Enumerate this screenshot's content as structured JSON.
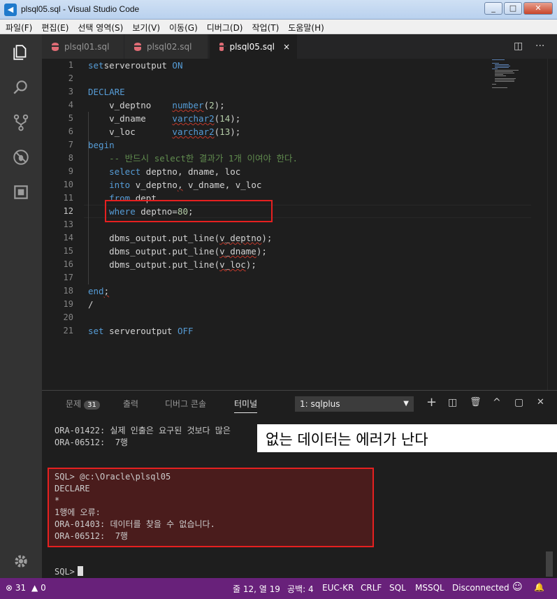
{
  "window": {
    "title": "plsql05.sql - Visual Studio Code",
    "app_icon": "vscode-icon",
    "min": "_",
    "max": "□",
    "close": "✕"
  },
  "menu": [
    "파일(F)",
    "편집(E)",
    "선택 영역(S)",
    "보기(V)",
    "이동(G)",
    "디버그(D)",
    "작업(T)",
    "도움말(H)"
  ],
  "tabs": [
    {
      "label": "plsql01.sql",
      "active": false
    },
    {
      "label": "plsql02.sql",
      "active": false
    },
    {
      "label": "plsql05.sql",
      "active": true,
      "close": "×"
    }
  ],
  "tab_actions": {
    "split": "◫",
    "more": "···"
  },
  "editor": {
    "line_numbers": [
      "1",
      "2",
      "3",
      "4",
      "5",
      "6",
      "7",
      "8",
      "9",
      "10",
      "11",
      "12",
      "13",
      "14",
      "15",
      "16",
      "17",
      "18",
      "19",
      "20",
      "21"
    ],
    "current_line": "12",
    "lines": [
      [
        [
          "kw",
          "set"
        ],
        [
          "",
          "serveroutput "
        ],
        [
          "kw",
          "ON"
        ]
      ],
      [],
      [
        [
          "kw",
          "DECLARE"
        ]
      ],
      [
        [
          "",
          "    v_deptno    "
        ],
        [
          "ty",
          "number"
        ],
        [
          "",
          "("
        ],
        [
          "nm",
          "2"
        ],
        [
          "",
          "); "
        ]
      ],
      [
        [
          "",
          "    v_dname     "
        ],
        [
          "ty",
          "varchar2"
        ],
        [
          "",
          "("
        ],
        [
          "nm",
          "14"
        ],
        [
          "",
          ");"
        ]
      ],
      [
        [
          "",
          "    v_loc       "
        ],
        [
          "ty",
          "varchar2"
        ],
        [
          "",
          "("
        ],
        [
          "nm",
          "13"
        ],
        [
          "",
          ");"
        ]
      ],
      [
        [
          "kw",
          "begin"
        ]
      ],
      [
        [
          "cm",
          "    -- 반드시 select한 결과가 1개 이여야 한다."
        ]
      ],
      [
        [
          "",
          "    "
        ],
        [
          "kw",
          "select"
        ],
        [
          "",
          " deptno, dname, loc"
        ]
      ],
      [
        [
          "",
          "    "
        ],
        [
          "kw",
          "into"
        ],
        [
          "",
          " v_deptno"
        ],
        [
          "sq",
          ","
        ],
        [
          "",
          " v_dname, v_loc"
        ]
      ],
      [
        [
          "",
          "    "
        ],
        [
          "kw",
          "from"
        ],
        [
          "",
          " dept"
        ]
      ],
      [
        [
          "",
          "    "
        ],
        [
          "kw",
          "where"
        ],
        [
          "",
          " deptno="
        ],
        [
          "nm",
          "80"
        ],
        [
          "",
          ";"
        ]
      ],
      [],
      [
        [
          "",
          "    dbms_output.put_line("
        ],
        [
          "sq",
          "v_deptno"
        ],
        [
          "",
          ");"
        ]
      ],
      [
        [
          "",
          "    dbms_output.put_line("
        ],
        [
          "sq",
          "v_dname"
        ],
        [
          "",
          ");"
        ]
      ],
      [
        [
          "",
          "    dbms_output.put_line("
        ],
        [
          "sq",
          "v_loc"
        ],
        [
          "",
          ");"
        ]
      ],
      [],
      [
        [
          "kw",
          "end"
        ],
        [
          "sq",
          ";"
        ]
      ],
      [
        [
          "",
          "/"
        ]
      ],
      [],
      [
        [
          "kw",
          "set"
        ],
        [
          "",
          " serveroutput "
        ],
        [
          "kw",
          "OFF"
        ]
      ]
    ]
  },
  "panel": {
    "tabs": {
      "problems": "문제",
      "problems_count": "31",
      "output": "출력",
      "debug_console": "디버그 콘솔",
      "terminal": "터미널"
    },
    "terminal_select": "1: sqlplus",
    "actions": {
      "add": "+",
      "split": "◫",
      "delete": "🗑",
      "maximize": "^",
      "layout": "▢",
      "close": "✕"
    },
    "terminal_lines": [
      "ORA-01422: 실제 인출은 요구된 것보다 많은",
      "ORA-06512:  7행",
      "",
      "",
      "SQL> @c:\\Oracle\\plsql05",
      "DECLARE",
      "*",
      "1행에 오류:",
      "ORA-01403: 데이터를 찾을 수 없습니다.",
      "ORA-06512:  7행",
      "",
      "",
      "SQL>"
    ],
    "callout": "없는 데이터는 에러가 난다"
  },
  "statusbar": {
    "errors": "31",
    "warnings": "0",
    "position": "줄 12, 열 19",
    "spaces": "공백: 4",
    "encoding": "EUC-KR",
    "eol": "CRLF",
    "language": "SQL",
    "connection_type": "MSSQL",
    "connection": "Disconnected"
  },
  "colors": {
    "statusbar": "#68217a",
    "keyword": "#569cd6",
    "number": "#b5cea8",
    "comment": "#608b4e",
    "highlight": "#e62020"
  }
}
